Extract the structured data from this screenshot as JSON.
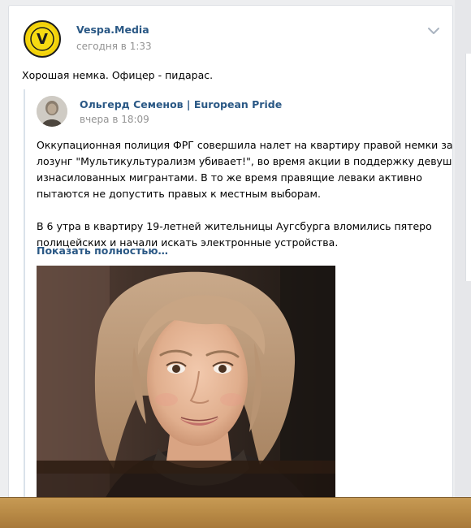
{
  "post": {
    "author": "Vespa.Media",
    "time": "сегодня в 1:33",
    "text": "Хорошая немка. Офицер - пидарас.",
    "logo_letter": "V",
    "logo_color": "#f2d10a",
    "menu_icon": "chevron-down-icon"
  },
  "repost": {
    "author": "Ольгерд Семенов | European Pride",
    "time": "вчера в 18:09",
    "paragraph1": [
      "Оккупационная полиция ФРГ совершила налет на квартиру правой немки за",
      "лозунг \"Мультикультурализм убивает!\", во время акции в поддержку девушек",
      "изнасилованных мигрантами. В то же время правящие леваки активно",
      "пытаются не допустить правых к местным выборам."
    ],
    "paragraph2": [
      "В 6 утра в квартиру 19-летней жительницы Аугсбурга вломились пятеро",
      "полицейских и начали искать электронные устройства."
    ],
    "show_more": "Показать полностью…"
  },
  "colors": {
    "link": "#2a5885",
    "muted": "#939393",
    "background": "#edeef0"
  }
}
